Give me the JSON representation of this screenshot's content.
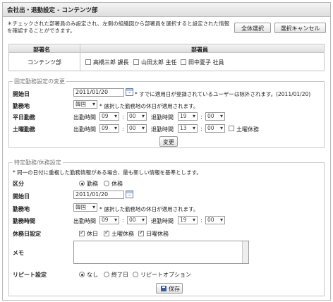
{
  "header": {
    "title": "会社出・退勤設定 - コンテンツ部"
  },
  "intro": {
    "note": "＊チェックされた部署員のみ設定され、左側の組織図から部署員を選択すると設定された情報を確認することができます。"
  },
  "buttons": {
    "select_all": "全体選択",
    "cancel_select": "選択キャンセル",
    "change": "変更",
    "save": "保存"
  },
  "table": {
    "col_dept": "部署名",
    "col_members": "部署員",
    "dept": "コンテンツ部",
    "members": [
      {
        "name": "高橋三郎 課長",
        "checked": false
      },
      {
        "name": "山田太郎 主任",
        "checked": false
      },
      {
        "name": "田中夏子 社員",
        "checked": false
      }
    ]
  },
  "fixed": {
    "legend": "固定勤務設定の変更",
    "start_label": "開始日",
    "start_value": "2011/01/20",
    "start_note": "* すでに適用日が登録されているユーザーは除外されます。(2011/01/20)",
    "location_label": "勤務地",
    "location_value": "韓国",
    "location_note": "* 選択した勤務地の休日が適用されます。",
    "weekday_label": "平日勤務",
    "saturday_label": "土曜勤務",
    "in_label": "出勤時間",
    "out_label": "退勤時間",
    "weekday_in_h": "09",
    "weekday_in_m": "00",
    "weekday_out_h": "19",
    "weekday_out_m": "00",
    "sat_in_h": "09",
    "sat_in_m": "00",
    "sat_out_h": "13",
    "sat_out_m": "00",
    "sat_off_label": "土曜休務",
    "sat_off": false,
    "colon": ":"
  },
  "special": {
    "legend": "特定勤務/休務設定",
    "note": "* 同一の日付に重複した勤務情報がある場合、最も新しい情報を基準とします。",
    "type_label": "区分",
    "type_work": "勤務",
    "type_off": "休務",
    "type_selected": "勤務",
    "start_label": "開始日",
    "start_value": "2011/01/20",
    "location_label": "勤務地",
    "location_value": "韓国",
    "location_note": "* 選択した勤務地の休日が適用されます。",
    "hours_label": "勤務時間",
    "in_label": "出勤時間",
    "out_label": "退勤時間",
    "in_h": "09",
    "in_m": "00",
    "out_h": "19",
    "out_m": "00",
    "offday_label": "休務日設定",
    "off_holiday": "休日",
    "off_saturday": "土曜休務",
    "off_sunday": "日曜休務",
    "memo_label": "メモ",
    "repeat_label": "リピート設定",
    "repeat_none": "なし",
    "repeat_end": "終了日",
    "repeat_option": "リピートオプション",
    "repeat_selected": "なし",
    "colon": ":"
  }
}
